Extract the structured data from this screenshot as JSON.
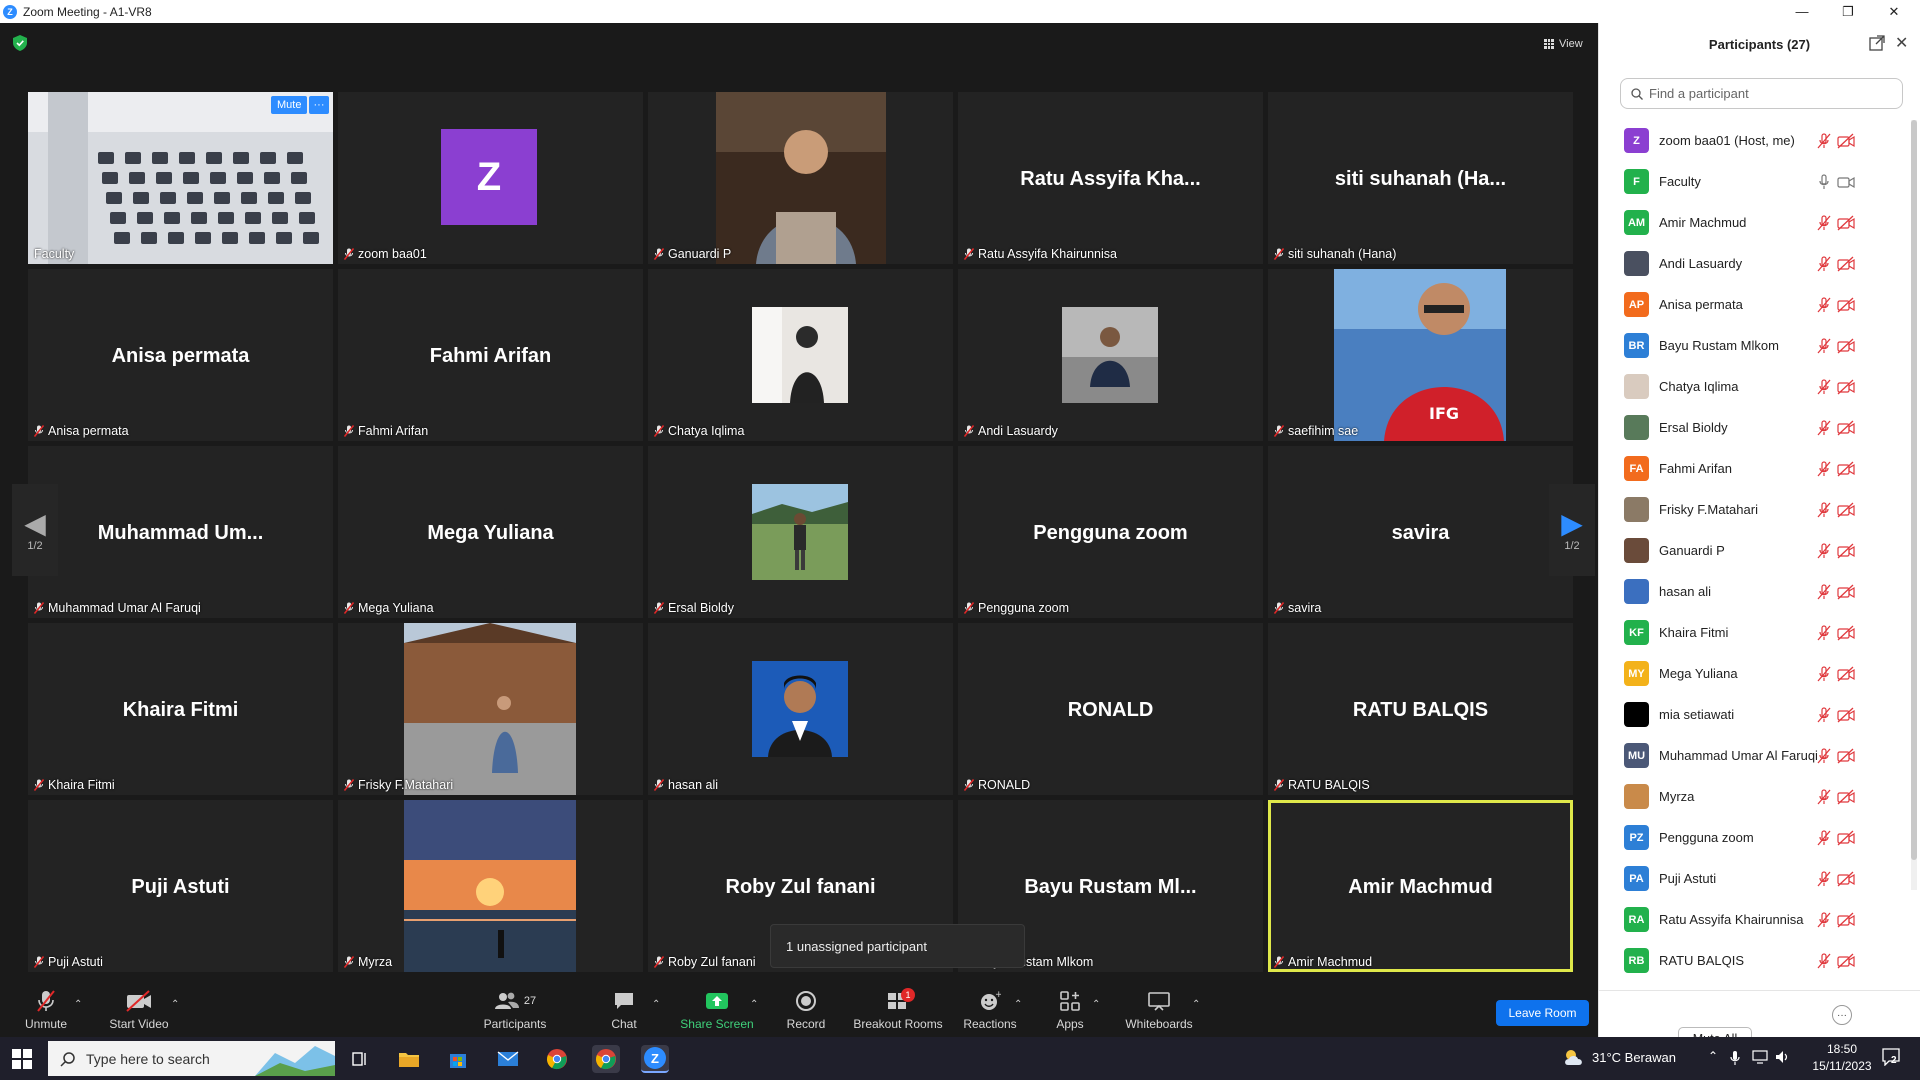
{
  "window": {
    "title": "Zoom Meeting - A1-VR8"
  },
  "view_label": "View",
  "tiles": [
    {
      "label": "Faculty",
      "big": "",
      "kind": "classroom",
      "mute_btn": "Mute",
      "more_btn": "···"
    },
    {
      "label": "zoom baa01",
      "big": "",
      "kind": "avatar",
      "avatar_letter": "Z"
    },
    {
      "label": "Ganuardi P",
      "big": "",
      "kind": "photo"
    },
    {
      "label": "Ratu Assyifa Khairunnisa",
      "big": "Ratu Assyifa Kha...",
      "kind": "name"
    },
    {
      "label": "siti suhanah (Hana)",
      "big": "siti suhanah (Ha...",
      "kind": "name"
    },
    {
      "label": "Anisa permata",
      "big": "Anisa permata",
      "kind": "name"
    },
    {
      "label": "Fahmi Arifan",
      "big": "Fahmi Arifan",
      "kind": "name"
    },
    {
      "label": "Chatya Iqlima",
      "big": "",
      "kind": "photo"
    },
    {
      "label": "Andi Lasuardy",
      "big": "",
      "kind": "photo"
    },
    {
      "label": "saefihim sae",
      "big": "",
      "kind": "photo"
    },
    {
      "label": "Muhammad Umar Al Faruqi",
      "big": "Muhammad  Um...",
      "kind": "name"
    },
    {
      "label": "Mega Yuliana",
      "big": "Mega Yuliana",
      "kind": "name"
    },
    {
      "label": "Ersal Bioldy",
      "big": "",
      "kind": "photo"
    },
    {
      "label": "Pengguna zoom",
      "big": "Pengguna zoom",
      "kind": "name"
    },
    {
      "label": "savira",
      "big": "savira",
      "kind": "name"
    },
    {
      "label": "Khaira Fitmi",
      "big": "Khaira Fitmi",
      "kind": "name"
    },
    {
      "label": "Frisky F.Matahari",
      "big": "",
      "kind": "photo"
    },
    {
      "label": "hasan ali",
      "big": "",
      "kind": "photo"
    },
    {
      "label": "RONALD",
      "big": "RONALD",
      "kind": "name"
    },
    {
      "label": "RATU BALQIS",
      "big": "RATU BALQIS",
      "kind": "name"
    },
    {
      "label": "Puji Astuti",
      "big": "Puji Astuti",
      "kind": "name"
    },
    {
      "label": "Myrza",
      "big": "",
      "kind": "photo"
    },
    {
      "label": "Roby Zul fanani",
      "big": "Roby Zul fanani",
      "kind": "name"
    },
    {
      "label": "Bayu Rustam Mlkom",
      "big": "Bayu Rustam Ml...",
      "kind": "name"
    },
    {
      "label": "Amir Machmud",
      "big": "Amir Machmud",
      "kind": "name",
      "active": true
    }
  ],
  "page_indicator": "1/2",
  "tooltip": "1 unassigned participant",
  "toolbar": {
    "unmute": "Unmute",
    "start_video": "Start Video",
    "participants": "Participants",
    "participants_count": "27",
    "chat": "Chat",
    "share_screen": "Share Screen",
    "record": "Record",
    "breakout_rooms": "Breakout Rooms",
    "breakout_badge": "1",
    "reactions": "Reactions",
    "apps": "Apps",
    "whiteboards": "Whiteboards",
    "leave": "Leave Room"
  },
  "panel": {
    "title": "Participants (27)",
    "search_placeholder": "Find a participant",
    "mute_all": "Mute All",
    "more": "···",
    "participants": [
      {
        "initials": "Z",
        "name": "zoom baa01 (Host, me)",
        "color": "#8b3fd1"
      },
      {
        "initials": "F",
        "name": "Faculty",
        "color": "#22b14c",
        "audio_on": true
      },
      {
        "initials": "AM",
        "name": "Amir Machmud",
        "color": "#22b14c"
      },
      {
        "initials": "",
        "name": "Andi Lasuardy",
        "color": "#4a5060"
      },
      {
        "initials": "AP",
        "name": "Anisa permata",
        "color": "#f26b1d"
      },
      {
        "initials": "BR",
        "name": "Bayu Rustam Mlkom",
        "color": "#2d7fd6"
      },
      {
        "initials": "",
        "name": "Chatya Iqlima",
        "color": "#d9cbbf"
      },
      {
        "initials": "",
        "name": "Ersal Bioldy",
        "color": "#587a5a"
      },
      {
        "initials": "FA",
        "name": "Fahmi Arifan",
        "color": "#f26b1d"
      },
      {
        "initials": "",
        "name": "Frisky F.Matahari",
        "color": "#8b7a66"
      },
      {
        "initials": "",
        "name": "Ganuardi P",
        "color": "#6a4b3a"
      },
      {
        "initials": "",
        "name": "hasan ali",
        "color": "#3b6fbf"
      },
      {
        "initials": "KF",
        "name": "Khaira Fitmi",
        "color": "#22b14c"
      },
      {
        "initials": "MY",
        "name": "Mega Yuliana",
        "color": "#f3b21a"
      },
      {
        "initials": "",
        "name": "mia setiawati",
        "color": "#000000"
      },
      {
        "initials": "MU",
        "name": "Muhammad Umar Al Faruqi",
        "color": "#4b5877"
      },
      {
        "initials": "",
        "name": "Myrza",
        "color": "#c98a4a"
      },
      {
        "initials": "PZ",
        "name": "Pengguna zoom",
        "color": "#2d7fd6"
      },
      {
        "initials": "PA",
        "name": "Puji Astuti",
        "color": "#2d7fd6"
      },
      {
        "initials": "RA",
        "name": "Ratu Assyifa Khairunnisa",
        "color": "#22b14c"
      },
      {
        "initials": "RB",
        "name": "RATU BALQIS",
        "color": "#22b14c"
      }
    ]
  },
  "taskbar": {
    "search_placeholder": "Type here to search",
    "weather": "31°C  Berawan",
    "time": "18:50",
    "date": "15/11/2023",
    "notif_count": "2"
  }
}
